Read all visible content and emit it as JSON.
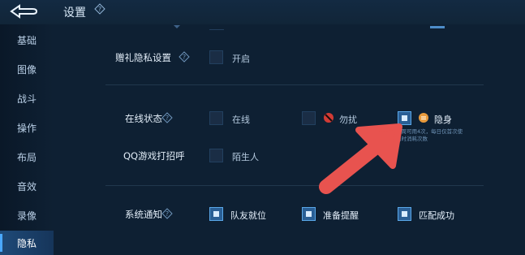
{
  "header": {
    "title": "设置"
  },
  "sidebar": {
    "items": [
      {
        "label": "基础"
      },
      {
        "label": "图像"
      },
      {
        "label": "战斗"
      },
      {
        "label": "操作"
      },
      {
        "label": "布局"
      },
      {
        "label": "音效"
      },
      {
        "label": "录像"
      },
      {
        "label": "隐私",
        "active": true
      }
    ]
  },
  "gift_privacy": {
    "label": "赠礼隐私设置",
    "option": "开启"
  },
  "online_status": {
    "label": "在线状态",
    "options": [
      "在线",
      "勿扰",
      "隐身"
    ],
    "note_line1": "本周可用4次，每日仅首次使",
    "note_line2": "用时消耗次数"
  },
  "qq_greeting": {
    "label": "QQ游戏打招呼",
    "option": "陌生人"
  },
  "system_notify": {
    "label": "系统通知",
    "options": [
      "队友就位",
      "准备提醒",
      "匹配成功"
    ]
  },
  "colors": {
    "accent": "#4aa8ff",
    "arrow": "#e8534f",
    "dnd": "#d23b35",
    "invisible": "#e89a3c"
  }
}
